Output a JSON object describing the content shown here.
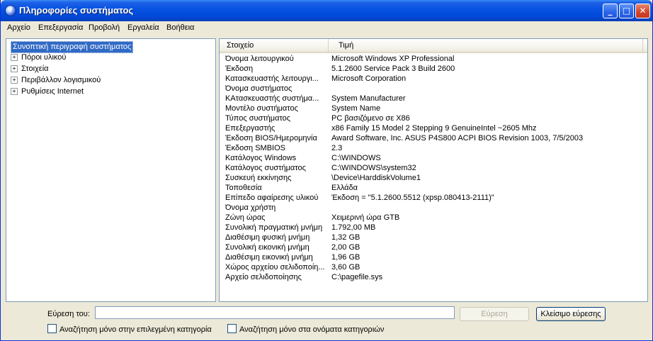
{
  "window": {
    "title": "Πληροφορίες συστήματος",
    "icon": "help-question-icon"
  },
  "titlebar_buttons": {
    "minimize": "_",
    "maximize": "□",
    "close": "✕"
  },
  "menu": [
    "Αρχείο",
    "Επεξεργασία",
    "Προβολή",
    "Εργαλεία",
    "Βοήθεια"
  ],
  "tree": {
    "root": "Συνοπτική περιγραφή συστήματος",
    "items": [
      {
        "label": "Πόροι υλικού",
        "expander": "+"
      },
      {
        "label": "Στοιχεία",
        "expander": "+"
      },
      {
        "label": "Περιβάλλον λογισμικού",
        "expander": "+"
      },
      {
        "label": "Ρυθμίσεις Internet",
        "expander": "+"
      }
    ]
  },
  "list": {
    "columns": [
      "Στοιχείο",
      "Τιμή"
    ],
    "rows": [
      {
        "key": "Όνομα λειτουργικού",
        "value": "Microsoft Windows XP Professional"
      },
      {
        "key": "Έκδοση",
        "value": "5.1.2600 Service Pack 3 Build 2600"
      },
      {
        "key": "Κατασκευαστής λειτουργι...",
        "value": "Microsoft Corporation"
      },
      {
        "key": "Όνομα συστήματος",
        "value": ""
      },
      {
        "key": "ΚΑτασκευαστής συστήμα...",
        "value": "System Manufacturer"
      },
      {
        "key": "Μοντέλο συστήματος",
        "value": "System Name"
      },
      {
        "key": "Τύπος συστήματος",
        "value": "PC βασιζόμενο σε X86"
      },
      {
        "key": "Επεξεργαστής",
        "value": "x86 Family 15 Model 2 Stepping 9 GenuineIntel ~2605 Mhz"
      },
      {
        "key": "Έκδοση BIOS/Ημερομηνία",
        "value": "Award Software, Inc. ASUS P4S800 ACPI BIOS Revision 1003, 7/5/2003"
      },
      {
        "key": "Έκδοση SMBIOS",
        "value": "2.3"
      },
      {
        "key": "Κατάλογος Windows",
        "value": "C:\\WINDOWS"
      },
      {
        "key": "Κατάλογος συστήματος",
        "value": "C:\\WINDOWS\\system32"
      },
      {
        "key": "Συσκευή εκκίνησης",
        "value": "\\Device\\HarddiskVolume1"
      },
      {
        "key": "Τοποθεσία",
        "value": "Ελλάδα"
      },
      {
        "key": "Επίπεδο αφαίρεσης υλικού",
        "value": "Έκδοση = \"5.1.2600.5512 (xpsp.080413-2111)\""
      },
      {
        "key": "Όνομα χρήστη",
        "value": ""
      },
      {
        "key": "Ζώνη ώρας",
        "value": "Χειμερινή ώρα GTB"
      },
      {
        "key": "Συνολική πραγματική μνήμη",
        "value": "1.792,00 MB"
      },
      {
        "key": "Διαθέσιμη φυσική μνήμη",
        "value": "1,32 GB"
      },
      {
        "key": "Συνολική εικονική μνήμη",
        "value": "2,00 GB"
      },
      {
        "key": "Διαθέσιμη εικονική μνήμη",
        "value": "1,96 GB"
      },
      {
        "key": "Χώρος αρχείου σελιδοποίη...",
        "value": "3,60 GB"
      },
      {
        "key": "Αρχείο σελιδοποίησης",
        "value": "C:\\pagefile.sys"
      }
    ]
  },
  "find": {
    "label": "Εύρεση του:",
    "value": "",
    "find_button": "Εύρεση",
    "close_button": "Κλείσιμο εύρεσης",
    "checkbox_selected_category": "Αναζήτηση μόνο στην επιλεγμένη κατηγορία",
    "checkbox_category_names": "Αναζήτηση μόνο στα ονόματα κατηγοριών"
  }
}
